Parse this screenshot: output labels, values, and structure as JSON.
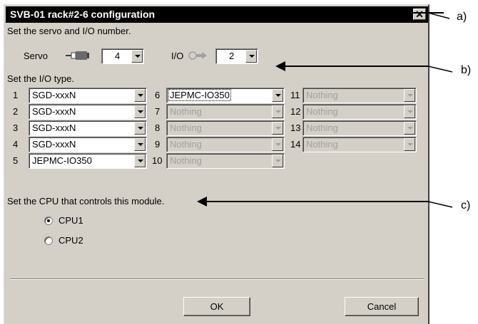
{
  "dialog": {
    "title": "SVB-01 rack#2-6 configuration",
    "close_glyph": "✕",
    "instruction_numbers": "Set the servo and I/O number.",
    "servo_label": "Servo",
    "servo_value": "4",
    "io_label": "I/O",
    "io_value": "2",
    "instruction_io_type": "Set the I/O type.",
    "io_slots": [
      {
        "num": "1",
        "value": "SGD-xxxN",
        "enabled": true
      },
      {
        "num": "2",
        "value": "SGD-xxxN",
        "enabled": true
      },
      {
        "num": "3",
        "value": "SGD-xxxN",
        "enabled": true
      },
      {
        "num": "4",
        "value": "SGD-xxxN",
        "enabled": true
      },
      {
        "num": "5",
        "value": "JEPMC-IO350",
        "enabled": true
      },
      {
        "num": "6",
        "value": "JEPMC-IO350",
        "enabled": true
      },
      {
        "num": "7",
        "value": "Nothing",
        "enabled": false
      },
      {
        "num": "8",
        "value": "Nothing",
        "enabled": false
      },
      {
        "num": "9",
        "value": "Nothing",
        "enabled": false
      },
      {
        "num": "10",
        "value": "Nothing",
        "enabled": false
      },
      {
        "num": "11",
        "value": "Nothing",
        "enabled": false
      },
      {
        "num": "12",
        "value": "Nothing",
        "enabled": false
      },
      {
        "num": "13",
        "value": "Nothing",
        "enabled": false
      },
      {
        "num": "14",
        "value": "Nothing",
        "enabled": false
      }
    ],
    "instruction_cpu": "Set the CPU that controls this module.",
    "cpu_options": [
      {
        "label": "CPU1",
        "selected": true
      },
      {
        "label": "CPU2",
        "selected": false
      }
    ],
    "ok_label": "OK",
    "cancel_label": "Cancel"
  },
  "annotations": {
    "a": "a)",
    "b": "b)",
    "c": "c)"
  },
  "icons": {
    "servo": "servo-connector-icon",
    "io": "io-connector-icon"
  }
}
